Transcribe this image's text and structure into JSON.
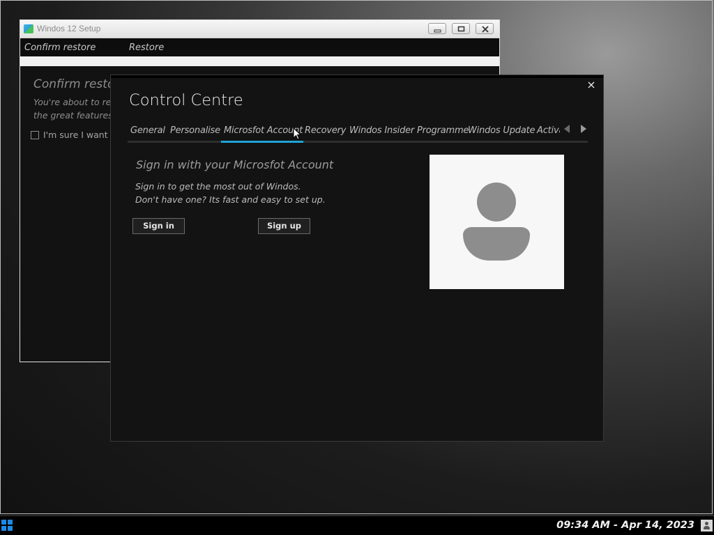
{
  "setup_window": {
    "title": "Windos 12 Setup",
    "steps": [
      "Confirm restore",
      "Restore"
    ],
    "heading": "Confirm restore",
    "description": "You're about to res\nthe great features o",
    "checkbox_label": "I'm sure I want to",
    "checkbox_checked": false
  },
  "control_centre": {
    "title": "Control Centre",
    "close_symbol": "×",
    "tabs": [
      {
        "label": "General"
      },
      {
        "label": "Personalise"
      },
      {
        "label": "Microsfot Account"
      },
      {
        "label": "Recovery"
      },
      {
        "label": "Windos Insider Programme"
      },
      {
        "label": "Windos Update"
      },
      {
        "label": "Activation"
      }
    ],
    "active_tab": "Microsfot Account",
    "accent_color": "#1fa5d6",
    "signin": {
      "title": "Sign in with your Microsfot Account",
      "description": "Sign in to get the most out of Windos.\nDon't have one? Its fast and easy to set up.",
      "signin_button": "Sign in",
      "signup_button": "Sign up"
    },
    "avatar_icon": "user-avatar-icon"
  },
  "taskbar": {
    "clock": "09:34 AM - Apr 14, 2023",
    "start_icon": "windows-logo-icon",
    "tray_icon": "user-icon"
  }
}
